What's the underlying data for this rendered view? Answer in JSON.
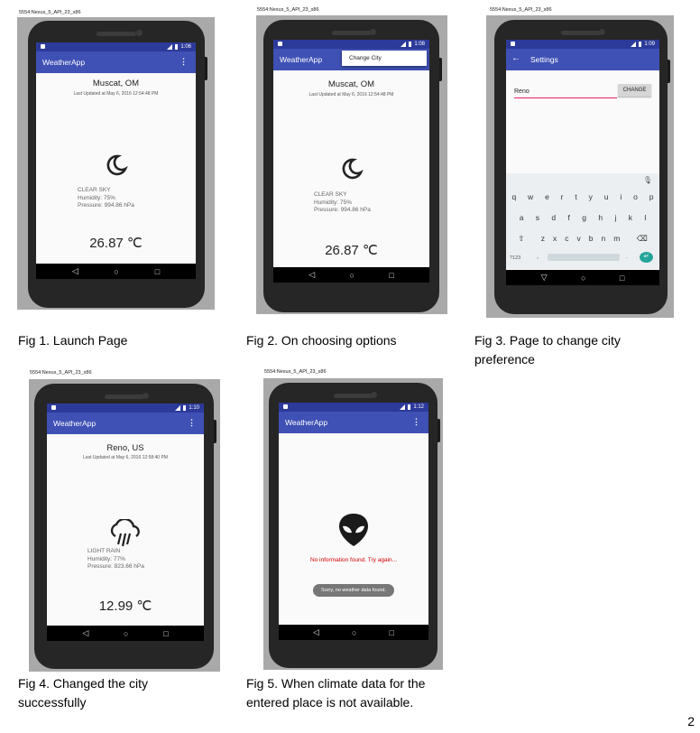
{
  "device_label": "5554:Nexus_5_API_23_x86",
  "page_number": "2",
  "app_title": "WeatherApp",
  "menu_glyph": "⋮",
  "nav": {
    "back": "◁",
    "home": "○",
    "recent": "□"
  },
  "status_times": {
    "fig1": "1:06",
    "fig2": "1:08",
    "fig3": "1:09",
    "fig4": "1:10",
    "fig5": "1:12"
  },
  "muscat": {
    "city": "Muscat, OM",
    "updated": "Last Updated at May 6, 2016 12:54:48 PM",
    "condition": "CLEAR SKY",
    "humidity": "Humidity: 75%",
    "pressure": "Pressure: 994.86 hPa",
    "temp": "26.87 ℃"
  },
  "reno": {
    "city": "Reno, US",
    "updated": "Last Updated at May 6, 2016 12:58:40 PM",
    "condition": "LIGHT RAIN",
    "humidity": "Humidity: 77%",
    "pressure": "Pressure: 823.66 hPa",
    "temp": "12.99 ℃"
  },
  "popup_item": "Change City",
  "settings": {
    "title": "Settings",
    "back_glyph": "←",
    "input_value": "Reno",
    "button": "CHANGE",
    "keyboard": {
      "row1": [
        "q",
        "w",
        "e",
        "r",
        "t",
        "y",
        "u",
        "i",
        "o",
        "p"
      ],
      "row2": [
        "a",
        "s",
        "d",
        "f",
        "g",
        "h",
        "j",
        "k",
        "l"
      ],
      "row3": [
        "z",
        "x",
        "c",
        "v",
        "b",
        "n",
        "m"
      ],
      "symbols": "?123",
      "comma": ",",
      "period": "."
    }
  },
  "error": {
    "message": "No information found. Try again...",
    "toast": "Sorry, no weather data found."
  },
  "captions": {
    "fig1": "Fig 1. Launch Page",
    "fig2": "Fig 2. On choosing options",
    "fig3_l1": "Fig 3. Page to change city",
    "fig3_l2": "preference",
    "fig4_l1": "Fig 4. Changed the city",
    "fig4_l2": "successfully",
    "fig5_l1": "Fig 5. When climate data for the",
    "fig5_l2": "entered place is not available."
  }
}
